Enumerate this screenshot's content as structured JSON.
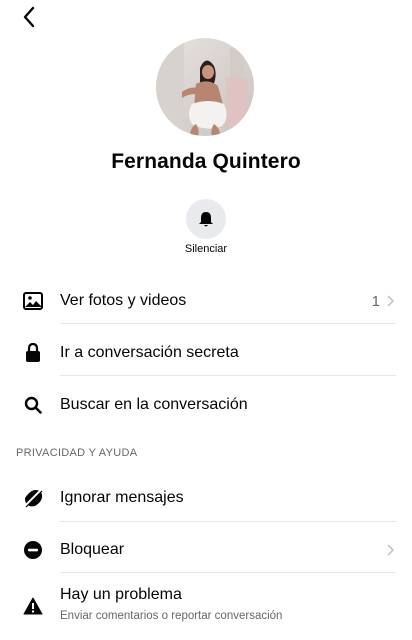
{
  "header": {
    "back_icon": "chevron-left-icon"
  },
  "profile": {
    "name": "Fernanda Quintero",
    "avatar": "profile-photo"
  },
  "quick_actions": {
    "mute_label": "Silenciar",
    "mute_icon": "bell-icon"
  },
  "menu": {
    "photos_label": "Ver fotos y videos",
    "photos_count": "1",
    "secret_label": "Ir a conversación secreta",
    "search_label": "Buscar en la conversación"
  },
  "privacy": {
    "header": "PRIVACIDAD Y AYUDA",
    "ignore_label": "Ignorar mensajes",
    "block_label": "Bloquear",
    "problem_label": "Hay un problema",
    "problem_sub": "Enviar comentarios o reportar conversación"
  }
}
